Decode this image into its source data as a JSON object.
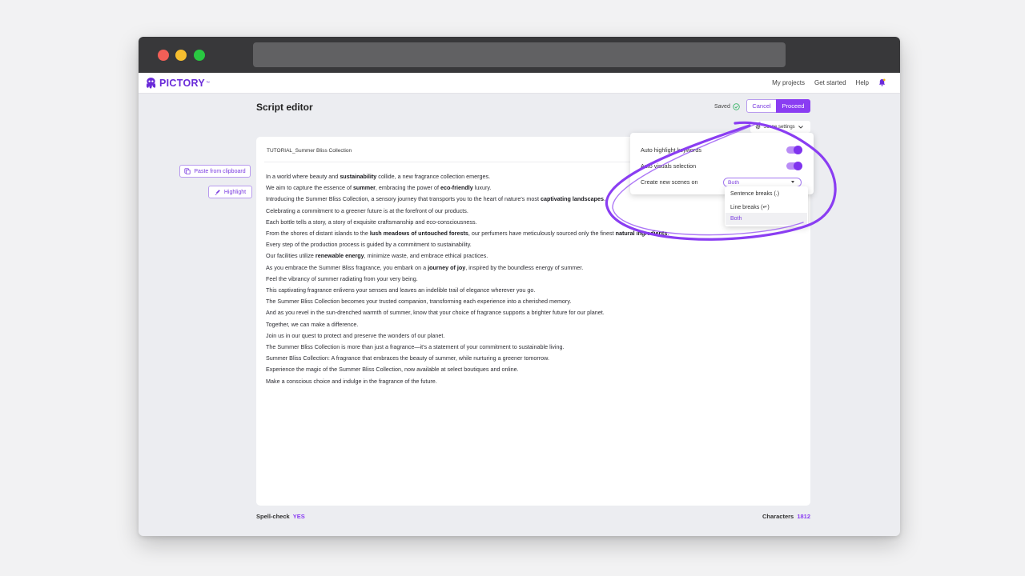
{
  "app": {
    "logo_text": "PICTORY",
    "logo_tm": "™",
    "nav": {
      "my_projects": "My projects",
      "get_started": "Get started",
      "help": "Help"
    }
  },
  "header": {
    "title": "Script editor",
    "saved": "Saved",
    "cancel": "Cancel",
    "proceed": "Proceed"
  },
  "sidebar": {
    "paste": "Paste from clipboard",
    "highlight": "Highlight"
  },
  "scene_settings": {
    "label": "Scene settings",
    "auto_highlight": "Auto highlight keywords",
    "auto_highlight_on": true,
    "auto_visuals": "Auto visuals selection",
    "auto_visuals_on": true,
    "create_scenes": "Create new scenes on",
    "selected": "Both",
    "options": [
      "Sentence breaks (.)",
      "Line breaks (↵)",
      "Both"
    ]
  },
  "editor": {
    "filename": "TUTORIAL_Summer Bliss Collection",
    "lines": [
      [
        {
          "t": "In a world where beauty and "
        },
        {
          "t": "sustainability",
          "b": true
        },
        {
          "t": " collide, a new fragrance collection emerges."
        }
      ],
      [
        {
          "t": "We aim to capture the essence of "
        },
        {
          "t": "summer",
          "b": true
        },
        {
          "t": ", embracing the power of "
        },
        {
          "t": "eco-friendly",
          "b": true
        },
        {
          "t": " luxury."
        }
      ],
      [
        {
          "t": "Introducing the Summer Bliss Collection, a sensory journey that transports you to the heart of nature's most "
        },
        {
          "t": "captivating landscapes",
          "b": true
        },
        {
          "t": "."
        }
      ],
      [
        {
          "t": "Celebrating a commitment to a greener future is at the forefront of our products."
        }
      ],
      [
        {
          "t": "Each bottle tells a story, a story of exquisite craftsmanship and eco-consciousness."
        }
      ],
      [
        {
          "t": "From the shores of distant islands to the "
        },
        {
          "t": "lush meadows of untouched forests",
          "b": true
        },
        {
          "t": ", our perfumers have meticulously sourced only the finest "
        },
        {
          "t": "natural ingredients",
          "b": true
        },
        {
          "t": "."
        }
      ],
      [
        {
          "t": "Every step of the production process is guided by a commitment to sustainability."
        }
      ],
      [
        {
          "t": "Our facilities utilize "
        },
        {
          "t": "renewable energy",
          "b": true
        },
        {
          "t": ", minimize waste, and embrace ethical practices."
        }
      ],
      [
        {
          "t": "As you embrace the Summer Bliss fragrance, you embark on a "
        },
        {
          "t": "journey of joy",
          "b": true
        },
        {
          "t": ", inspired by the boundless energy of summer."
        }
      ],
      [
        {
          "t": "Feel the vibrancy of summer radiating from your very being."
        }
      ],
      [
        {
          "t": "This captivating fragrance enlivens your senses and leaves an indelible trail of elegance wherever you go."
        }
      ],
      [
        {
          "t": "The Summer Bliss Collection becomes your trusted companion, transforming each experience into a cherished memory."
        }
      ],
      [
        {
          "t": "And as you revel in the sun-drenched warmth of summer, know that your choice of fragrance supports a brighter future for our planet."
        }
      ],
      [
        {
          "t": "Together, we can make a difference."
        }
      ],
      [
        {
          "t": "Join us in our quest to protect and preserve the wonders of our planet."
        }
      ],
      [
        {
          "t": "The Summer Bliss Collection is more than just a fragrance—it's a statement of your commitment to sustainable living."
        }
      ],
      [
        {
          "t": "Summer Bliss Collection: A fragrance that embraces the beauty of summer, while nurturing a greener tomorrow."
        }
      ],
      [
        {
          "t": "Experience the magic of the Summer Bliss Collection, now available at select boutiques and online."
        }
      ],
      [
        {
          "t": "Make a conscious choice and indulge in the fragrance of the future."
        }
      ]
    ]
  },
  "footer": {
    "spell_label": "Spell-check",
    "spell_value": "YES",
    "chars_label": "Characters",
    "chars_value": "1812"
  },
  "colors": {
    "accent": "#8a3df2",
    "annotation": "#8a3df2",
    "titlebar": "#38383a"
  }
}
